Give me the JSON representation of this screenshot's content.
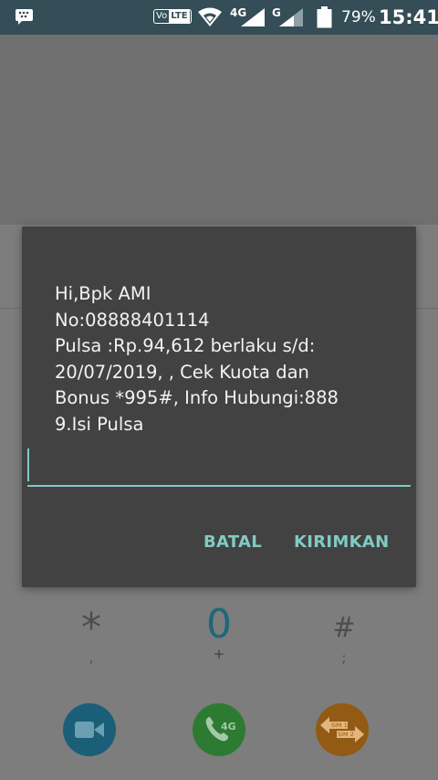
{
  "status_bar": {
    "volte_vo": "Vo",
    "volte_lte": "LTE",
    "network1": "4G",
    "network2": "G",
    "battery_percent": "79%",
    "time": "15:41"
  },
  "dialpad": {
    "star_key": "*",
    "star_sub": ",",
    "zero_key": "0",
    "zero_sub": "+",
    "hash_key": "#",
    "hash_sub": ";",
    "call_badge": "4G",
    "sim1_label": "SIM 1",
    "sim2_label": "SIM 2"
  },
  "dialog": {
    "message_lines": [
      "Hi,Bpk AMI",
      "No:08888401114",
      "Pulsa :Rp.94,612 berlaku s/d:",
      "20/07/2019, , Cek Kuota dan",
      "Bonus *995#, Info Hubungi:888",
      "9.Isi Pulsa"
    ],
    "reply_value": "",
    "cancel_label": "BATAL",
    "send_label": "KIRIMKAN"
  },
  "colors": {
    "status_bar": "#344d57",
    "dialog_bg": "#424242",
    "accent": "#80cbc4",
    "video_fab": "#1b5e78",
    "call_fab": "#2d7b33",
    "sim_fab": "#935a14"
  }
}
